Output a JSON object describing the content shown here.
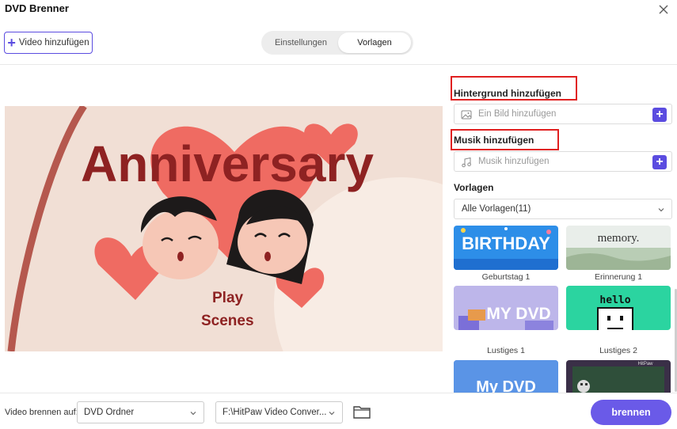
{
  "window": {
    "title": "DVD Brenner"
  },
  "toolbar": {
    "add_video_label": "Video hinzufügen"
  },
  "tabs": [
    {
      "label": "Einstellungen",
      "active": false
    },
    {
      "label": "Vorlagen",
      "active": true
    }
  ],
  "preview": {
    "title": "Anniversary",
    "menu": [
      "Play",
      "Scenes"
    ]
  },
  "sidebar": {
    "background": {
      "label": "Hintergrund hinzufügen",
      "placeholder": "Ein Bild hinzufügen"
    },
    "music": {
      "label": "Musik hinzufügen",
      "placeholder": "Musik hinzufügen"
    },
    "templates": {
      "label": "Vorlagen",
      "filter_value": "Alle Vorlagen(11)",
      "items": [
        {
          "label": "Geburtstag 1",
          "thumb_text": "BIRTHDAY"
        },
        {
          "label": "Erinnerung 1",
          "thumb_text": "memory."
        },
        {
          "label": "Lustiges 1",
          "thumb_text": "MY DVD"
        },
        {
          "label": "Lustiges 2",
          "thumb_text": "hello"
        },
        {
          "label": "",
          "thumb_text": "My DVD"
        },
        {
          "label": "",
          "thumb_text": "HitPaw"
        }
      ]
    }
  },
  "footer": {
    "burn_to_label": "Video brennen auf:",
    "target_value": "DVD Ordner",
    "path_value": "F:\\HitPaw Video Conver...",
    "burn_label": "brennen"
  },
  "colors": {
    "accent": "#5b4ce0",
    "highlight": "#e02020",
    "preview_title": "#8e2222"
  }
}
